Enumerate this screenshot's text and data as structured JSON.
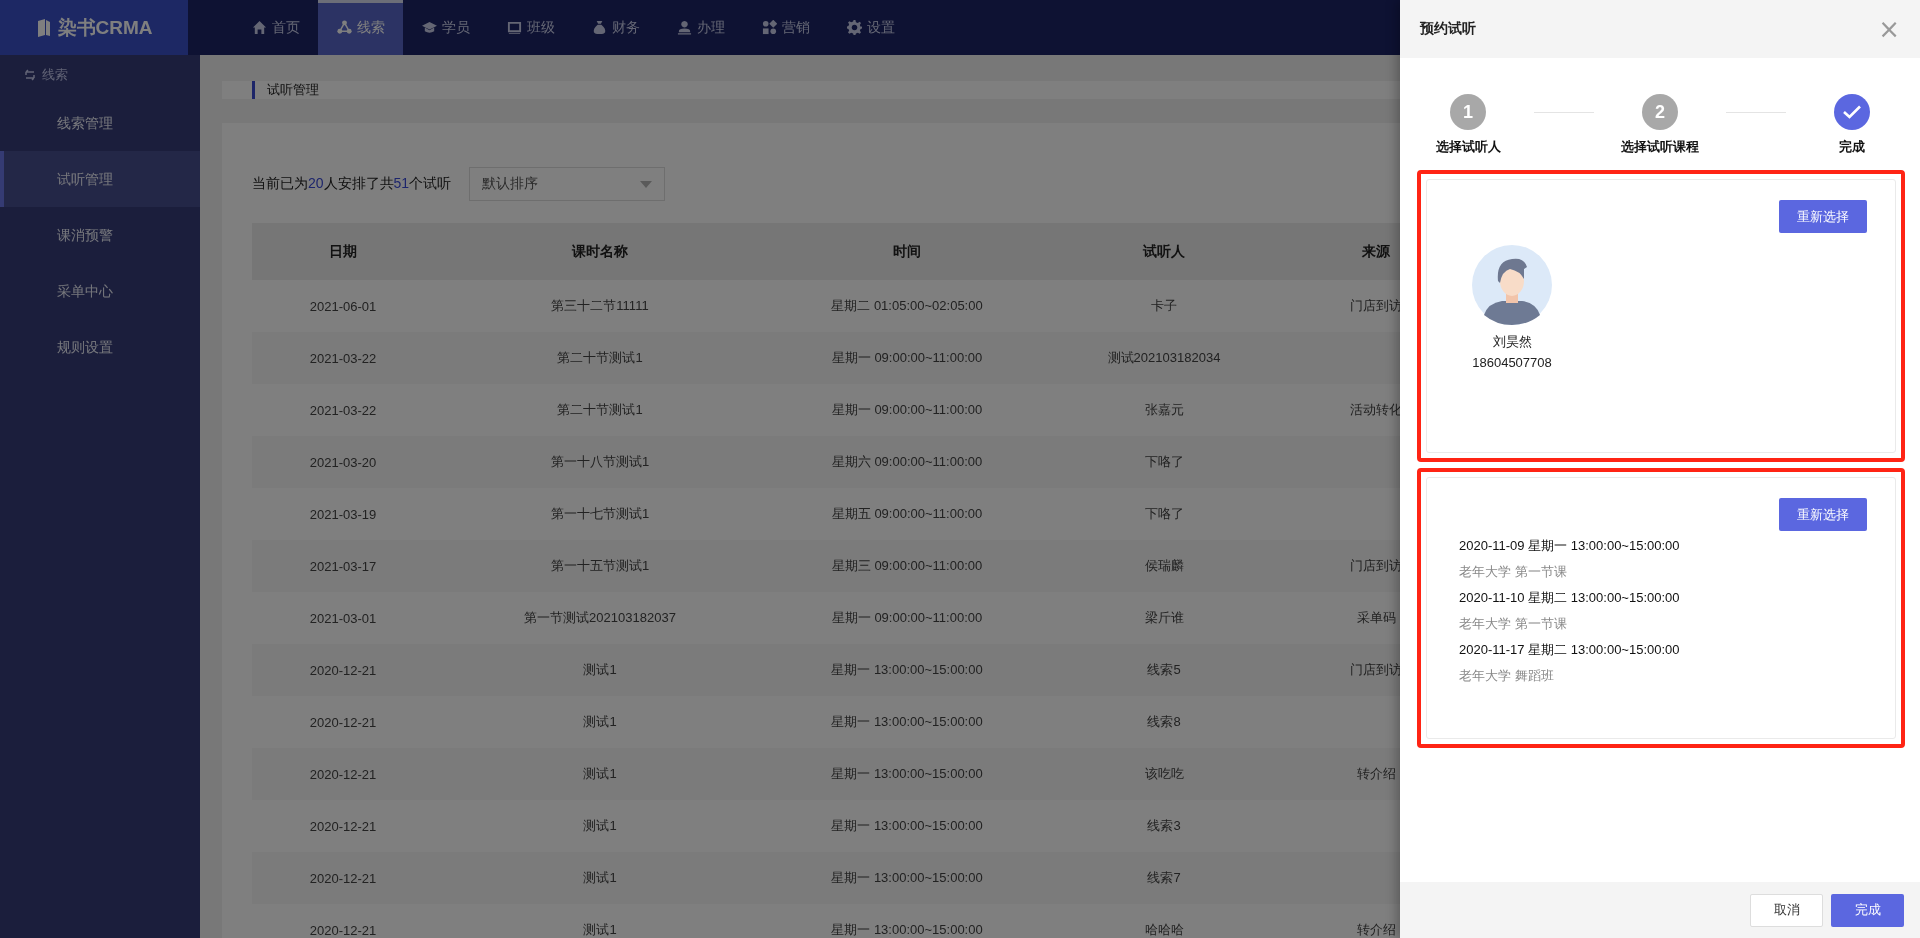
{
  "topbar": {
    "logo": "染书CRMA",
    "nav": [
      {
        "label": "首页",
        "kind": "home",
        "selected": false
      },
      {
        "label": "线索",
        "kind": "network",
        "selected": true
      },
      {
        "label": "学员",
        "kind": "cap",
        "selected": false
      },
      {
        "label": "班级",
        "kind": "board",
        "selected": false
      },
      {
        "label": "财务",
        "kind": "bag",
        "selected": false
      },
      {
        "label": "办理",
        "kind": "person",
        "selected": false
      },
      {
        "label": "营销",
        "kind": "shapes",
        "selected": false
      },
      {
        "label": "设置",
        "kind": "gear",
        "selected": false
      }
    ]
  },
  "sidebar": {
    "section": "线索",
    "items": [
      {
        "label": "线索管理",
        "selected": false
      },
      {
        "label": "试听管理",
        "selected": true
      },
      {
        "label": "课消预警",
        "selected": false
      },
      {
        "label": "采单中心",
        "selected": false
      },
      {
        "label": "规则设置",
        "selected": false
      }
    ]
  },
  "page_header": {
    "title": "试听管理"
  },
  "summary": [
    {
      "kind": "text",
      "text": "当前已为"
    },
    {
      "kind": "count",
      "text": "20"
    },
    {
      "kind": "text",
      "text": "人安排了共"
    },
    {
      "kind": "count",
      "text": "51"
    },
    {
      "kind": "text",
      "text": "个试听"
    }
  ],
  "sort_select": {
    "value": "默认排序"
  },
  "table": {
    "columns": [
      "日期",
      "课时名称",
      "时间",
      "试听人",
      "来源"
    ],
    "rows": [
      {
        "date": "2021-06-01",
        "lesson": "第三十二节11111",
        "time": "星期二 01:05:00~02:05:00",
        "student": "卡子",
        "source": "门店到访"
      },
      {
        "date": "2021-03-22",
        "lesson": "第二十节测试1",
        "time": "星期一 09:00:00~11:00:00",
        "student": "测试202103182034"
      },
      {
        "date": "2021-03-22",
        "lesson": "第二十节测试1",
        "time": "星期一 09:00:00~11:00:00",
        "student": "张嘉元",
        "source": "活动转化"
      },
      {
        "date": "2021-03-20",
        "lesson": "第一十八节测试1",
        "time": "星期六 09:00:00~11:00:00",
        "student": "下咯了"
      },
      {
        "date": "2021-03-19",
        "lesson": "第一十七节测试1",
        "time": "星期五 09:00:00~11:00:00",
        "student": "下咯了"
      },
      {
        "date": "2021-03-17",
        "lesson": "第一十五节测试1",
        "time": "星期三 09:00:00~11:00:00",
        "student": "侯瑞麟",
        "source": "门店到访"
      },
      {
        "date": "2021-03-01",
        "lesson": "第一节测试202103182037",
        "time": "星期一 09:00:00~11:00:00",
        "student": "梁斤谁",
        "source": "采单码"
      },
      {
        "date": "2020-12-21",
        "lesson": "测试1",
        "time": "星期一 13:00:00~15:00:00",
        "student": "线索5",
        "source": "门店到访"
      },
      {
        "date": "2020-12-21",
        "lesson": "测试1",
        "time": "星期一 13:00:00~15:00:00",
        "student": "线索8"
      },
      {
        "date": "2020-12-21",
        "lesson": "测试1",
        "time": "星期一 13:00:00~15:00:00",
        "student": "该吃吃",
        "source": "转介绍"
      },
      {
        "date": "2020-12-21",
        "lesson": "测试1",
        "time": "星期一 13:00:00~15:00:00",
        "student": "线索3"
      },
      {
        "date": "2020-12-21",
        "lesson": "测试1",
        "time": "星期一 13:00:00~15:00:00",
        "student": "线索7"
      },
      {
        "date": "2020-12-21",
        "lesson": "测试1",
        "time": "星期一 13:00:00~15:00:00",
        "student": "哈哈哈",
        "source": "转介绍"
      }
    ]
  },
  "drawer": {
    "title": "预约试听",
    "close": "×",
    "steps": [
      {
        "number": "1",
        "label": "选择试听人",
        "selected": false
      },
      {
        "number": "2",
        "label": "选择试听课程",
        "selected": false
      },
      {
        "label": "完成",
        "selected": true
      }
    ],
    "student_card": {
      "highlighted": true,
      "button": "重新选择",
      "name": "刘昊然",
      "phone": "18604507708"
    },
    "course_card": {
      "highlighted": true,
      "button": "重新选择",
      "sessions": [
        {
          "time": "2020-11-09 星期一 13:00:00~15:00:00",
          "course": "老年大学 第一节课"
        },
        {
          "time": "2020-11-10 星期二 13:00:00~15:00:00",
          "course": "老年大学 第一节课"
        },
        {
          "time": "2020-11-17 星期二 13:00:00~15:00:00",
          "course": "老年大学 舞蹈班"
        }
      ]
    },
    "buttons": [
      {
        "label": "取消",
        "kind": "default"
      },
      {
        "label": "完成",
        "kind": "primary"
      }
    ]
  }
}
